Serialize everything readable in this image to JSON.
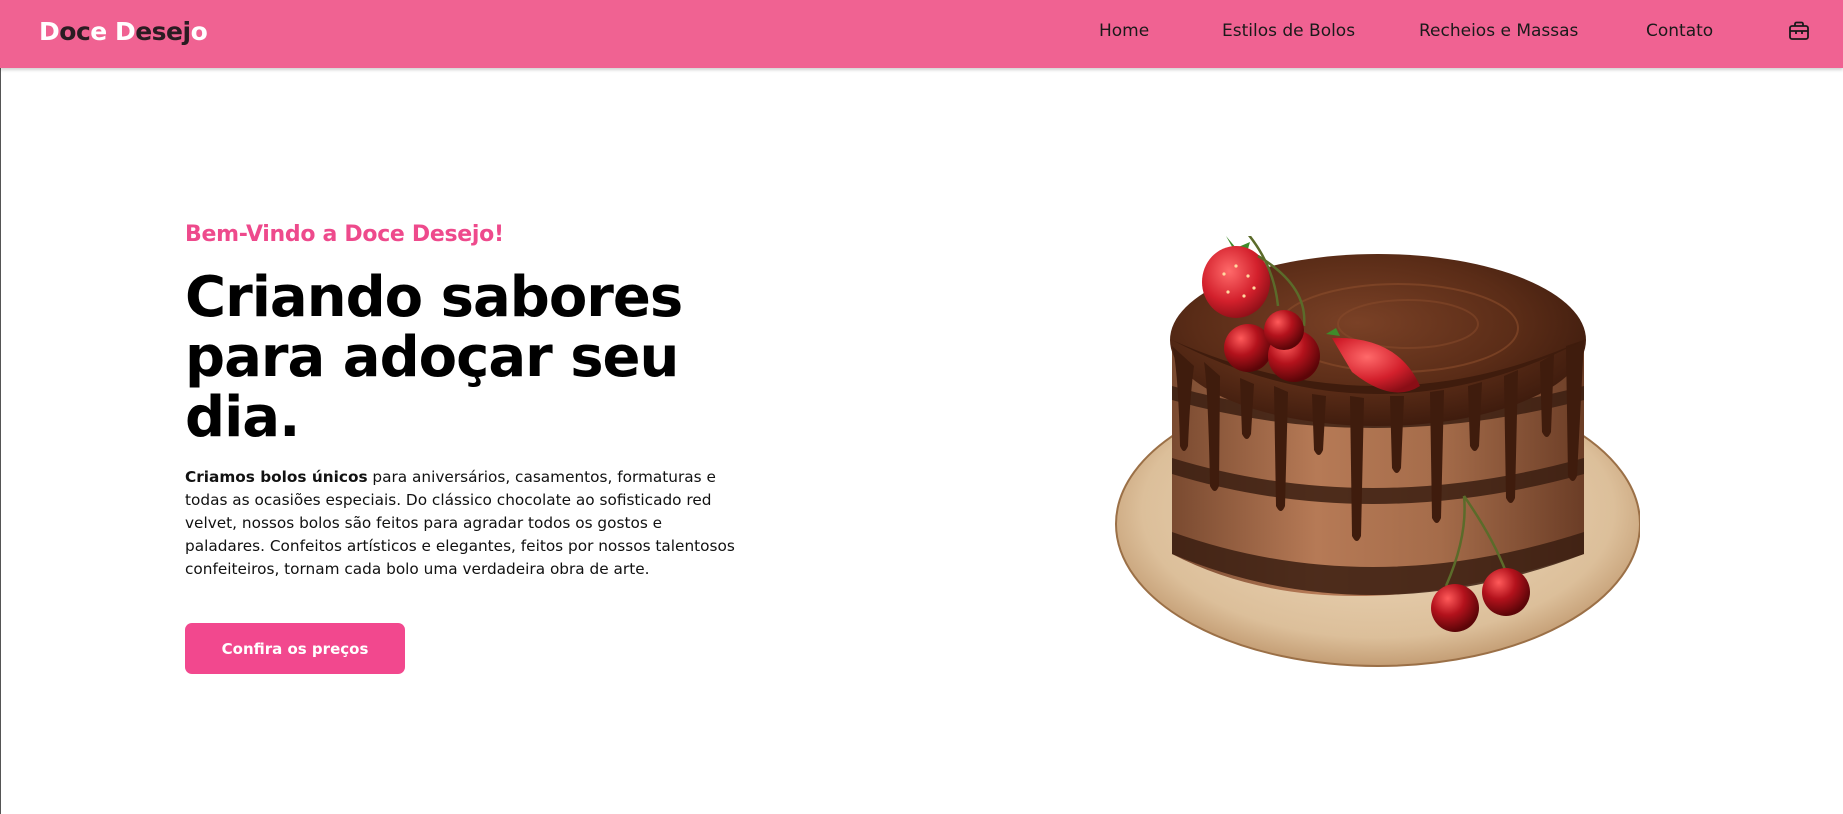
{
  "brand": {
    "name_parts": [
      {
        "text": "D",
        "style": "cap"
      },
      {
        "text": "oc",
        "style": "low"
      },
      {
        "text": "e",
        "style": "cap"
      },
      {
        "text": " ",
        "style": "low"
      },
      {
        "text": "D",
        "style": "cap"
      },
      {
        "text": "esej",
        "style": "low"
      },
      {
        "text": "o",
        "style": "cap"
      }
    ]
  },
  "nav": {
    "home": "Home",
    "estilos": "Estilos de Bolos",
    "recheios": "Recheios e Massas",
    "contato": "Contato",
    "cart_icon": "shopping-bag-icon"
  },
  "hero": {
    "welcome": "Bem-Vindo a Doce Desejo!",
    "headline": "Criando sabores para adoçar seu dia.",
    "description_bold": "Criamos bolos únicos",
    "description_rest": " para aniversários, casamentos, formaturas e todas as ocasiões especiais. Do clássico chocolate ao sofisticado red velvet, nossos bolos são feitos para agradar todos os gostos e paladares. Confeitos artísticos e elegantes, feitos por nossos talentosos confeiteiros, tornam cada bolo uma verdadeira obra de arte.",
    "cta": "Confira os preços",
    "image": "chocolate-drip-cake-with-strawberries-and-cherries"
  },
  "colors": {
    "nav_bg": "#f06292",
    "accent": "#ee4a8c",
    "button": "#f2488e"
  }
}
